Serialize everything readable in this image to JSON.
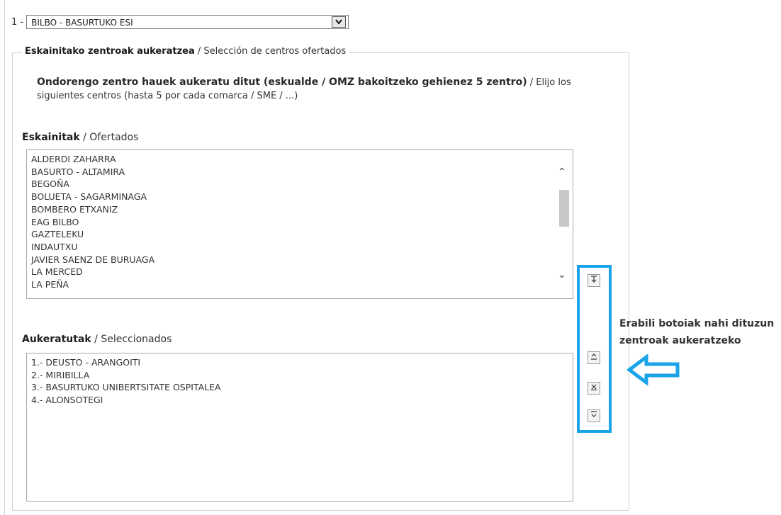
{
  "top": {
    "index_label": "1 -",
    "selected_value": "BILBO - BASURTUKO ESI"
  },
  "fieldset": {
    "legend_eu": "Eskainitako zentroak aukeratzea",
    "legend_es": " / Selección de centros ofertados"
  },
  "intro": {
    "eu": "Ondorengo zentro hauek aukeratu ditut (eskualde / OMZ bakoitzeko gehienez 5 zentro)",
    "es": " / Elijo los siguientes centros (hasta 5 por cada comarca / SME / ...)"
  },
  "offered": {
    "label_eu": "Eskainitak",
    "label_es": " / Ofertados",
    "items": [
      "ALDERDI ZAHARRA",
      "BASURTO - ALTAMIRA",
      "BEGOÑA",
      "BOLUETA - SAGARMINAGA",
      "BOMBERO ETXANIZ",
      "EAG BILBO",
      "GAZTELEKU",
      "INDAUTXU",
      "JAVIER SAENZ DE BURUAGA",
      "LA MERCED",
      "LA PEÑA"
    ]
  },
  "selected": {
    "label_eu": "Aukeratutak",
    "label_es": " / Seleccionados",
    "items": [
      "1.- DEUSTO - ARANGOITI",
      "2.- MIRIBILLA",
      "3.- BASURTUKO UNIBERTSITATE OSPITALEA",
      "4.- ALONSOTEGI"
    ]
  },
  "hint": {
    "line1": "Erabili botoiak nahi dituzun",
    "line2": "zentroak aukeratzeko"
  },
  "icons": {
    "add": "move-down-icon",
    "up": "move-up-icon",
    "remove": "remove-icon",
    "down": "move-bottom-icon"
  },
  "colors": {
    "highlight": "#1aa3e8"
  }
}
